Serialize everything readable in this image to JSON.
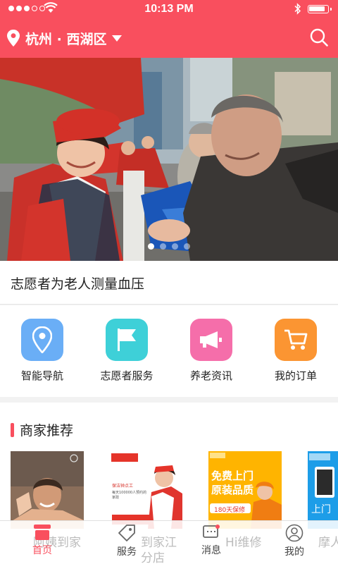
{
  "status_bar": {
    "time": "10:13 PM"
  },
  "header": {
    "location": "杭州 · 西湖区",
    "brand_color": "#f94f5e"
  },
  "banner": {
    "caption": "志愿者为老人测量血压",
    "slide_count": 4,
    "active_slide": 1
  },
  "quick_menu": [
    {
      "label": "智能导航",
      "icon": "location-pin-icon",
      "color": "#6aaef6"
    },
    {
      "label": "志愿者服务",
      "icon": "flag-icon",
      "color": "#3ed0d8"
    },
    {
      "label": "养老资讯",
      "icon": "megaphone-icon",
      "color": "#f56eaa"
    },
    {
      "label": "我的订单",
      "icon": "shopping-cart-icon",
      "color": "#fb9532"
    }
  ],
  "merchants": {
    "title": "商家推荐",
    "cards": [
      {
        "name": "spa-card"
      },
      {
        "name": "nanny-card",
        "headline": "保洁钟点工",
        "note": "每天100000人预约的家政"
      },
      {
        "name": "install-card",
        "headline": "免费上门",
        "sub": "原装品质",
        "note": "180天保修"
      },
      {
        "name": "repair-card",
        "headline": "上门"
      }
    ]
  },
  "tabbar": {
    "ghost_texts": [
      "阿姨到家",
      "到家江",
      "分店",
      "Hi维修",
      "摩人"
    ],
    "tabs": [
      {
        "label": "首页",
        "icon": "home-icon",
        "active": true
      },
      {
        "label": "服务",
        "icon": "service-tag-icon",
        "active": false
      },
      {
        "label": "消息",
        "icon": "message-icon",
        "active": false
      },
      {
        "label": "我的",
        "icon": "user-icon",
        "active": false
      }
    ]
  }
}
